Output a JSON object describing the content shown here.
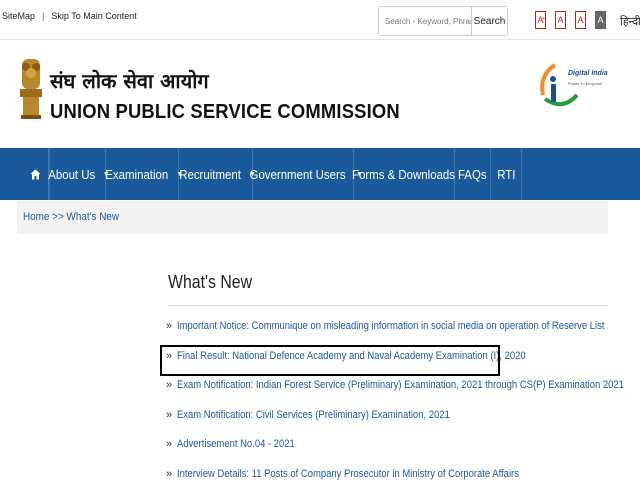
{
  "topbar": {
    "sitemap": "SiteMap",
    "skip": "Skip To Main Content",
    "search_placeholder": "Search - Keyword, Phrase",
    "search_button": "Search",
    "font_buttons": [
      "A",
      "A",
      "A",
      "A"
    ],
    "font_sup": [
      "+",
      "",
      "-",
      ""
    ],
    "hindi": "हिन्दी"
  },
  "header": {
    "org_hindi": "संघ लोक सेवा आयोग",
    "org_english": "UNION PUBLIC SERVICE COMMISSION",
    "digital_india_title": "Digital India",
    "digital_india_tag": "Power To Empower"
  },
  "nav": {
    "items": [
      {
        "label": "About Us",
        "caret": true
      },
      {
        "label": "Examination",
        "caret": true
      },
      {
        "label": "Recruitment",
        "caret": true
      },
      {
        "label": "Government Users",
        "caret": true
      },
      {
        "label": "Forms & Downloads",
        "caret": false
      },
      {
        "label": "FAQs",
        "caret": false
      },
      {
        "label": "RTI",
        "caret": false
      }
    ]
  },
  "breadcrumb": {
    "home": "Home",
    "separator": ">>",
    "current": "What's New"
  },
  "main": {
    "title": "What's New",
    "items": [
      "Important Notice: Communique on misleading information in social media on operation of Reserve List",
      "Final Result: National Defence Academy and Naval Academy Examination (I), 2020",
      "Exam Notification: Indian Forest Service (Preliminary) Examination, 2021 through CS(P) Examination 2021",
      "Exam Notification: Civil Services (Preliminary) Examination, 2021",
      "Advertisement No.04 - 2021",
      "Interview Details: 11 Posts of Company Prosecutor in Ministry of Corporate Affairs"
    ],
    "bullet": "»"
  },
  "colors": {
    "nav_bg": "#1a5a9a",
    "link": "#1a5a9a",
    "font_btn": "#bb2222"
  }
}
